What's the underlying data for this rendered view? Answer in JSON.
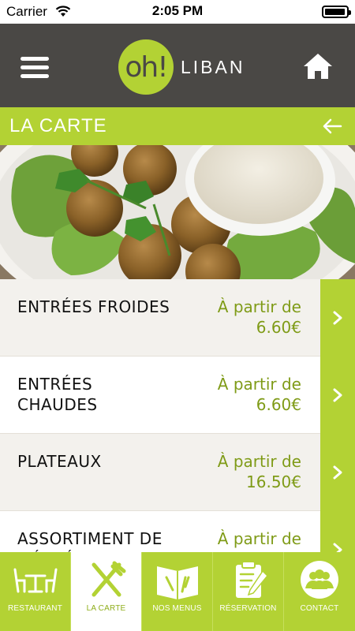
{
  "status_bar": {
    "carrier": "Carrier",
    "time": "2:05 PM",
    "battery_level": 0.95
  },
  "header": {
    "menu_icon": "hamburger-menu-icon",
    "logo_mark": "oh!",
    "logo_name": "LIBAN",
    "home_icon": "home-icon"
  },
  "title_bar": {
    "title": "LA CARTE",
    "back_icon": "arrow-left-icon"
  },
  "hero": {
    "image_subject": "falafel-with-sauce"
  },
  "menu_items": [
    {
      "name": "ENTRÉES FROIDES",
      "price_label": "À partir de",
      "price": "6.60€"
    },
    {
      "name": "ENTRÉES CHAUDES",
      "price_label": "À partir de",
      "price": "6.60€"
    },
    {
      "name": "PLATEAUX",
      "price_label": "À partir de",
      "price": "16.50€"
    },
    {
      "name": "ASSORTIMENT DE MÉZZÉS",
      "price_label": "À partir de",
      "price": ""
    }
  ],
  "tabs": [
    {
      "label": "RESTAURANT",
      "icon": "restaurant-table-icon",
      "active": false
    },
    {
      "label": "LA CARTE",
      "icon": "fork-knife-icon",
      "active": true
    },
    {
      "label": "NOS MENUS",
      "icon": "menu-book-icon",
      "active": false
    },
    {
      "label": "RÉSERVATION",
      "icon": "clipboard-pen-icon",
      "active": false
    },
    {
      "label": "CONTACT",
      "icon": "contact-people-icon",
      "active": false
    }
  ],
  "colors": {
    "accent": "#b3d234",
    "header_bg": "#4a4845",
    "price_text": "#7f9b17"
  }
}
